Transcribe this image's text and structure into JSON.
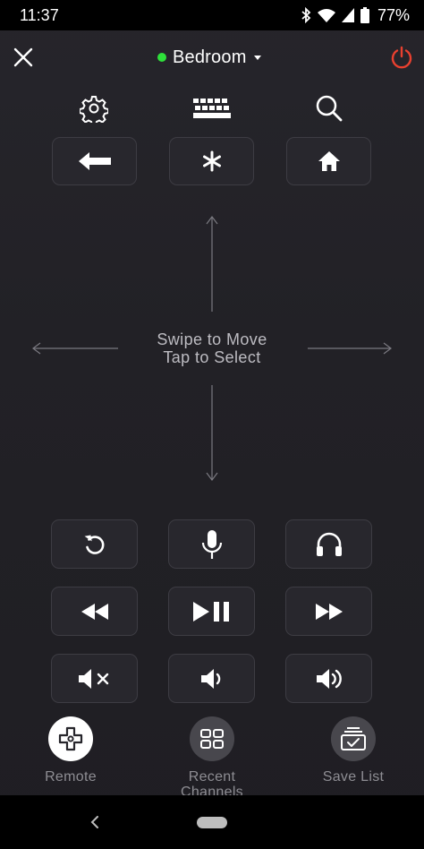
{
  "status_bar": {
    "time": "11:37",
    "battery": "77%",
    "icons": [
      "bluetooth-icon",
      "wifi-icon",
      "cell-signal-icon",
      "battery-icon"
    ]
  },
  "header": {
    "close_icon": "close-icon",
    "device_name": "Bedroom",
    "device_status_color": "#2ee03a",
    "power_icon": "power-icon",
    "power_color": "#e8402f"
  },
  "top_controls": [
    "gear-icon",
    "keyboard-icon",
    "search-icon"
  ],
  "nav_buttons": [
    "back-arrow-icon",
    "asterisk-icon",
    "home-icon"
  ],
  "swipe": {
    "line1": "Swipe to Move",
    "line2": "Tap to Select"
  },
  "control_grid": [
    [
      "replay-icon",
      "microphone-icon",
      "headphones-icon"
    ],
    [
      "rewind-icon",
      "play-pause-icon",
      "fast-forward-icon"
    ],
    [
      "mute-icon",
      "volume-down-icon",
      "volume-up-icon"
    ]
  ],
  "tabs": [
    {
      "label": "Remote",
      "icon": "dpad-icon",
      "active": true
    },
    {
      "label": "Recent Channels",
      "icon": "grid-icon",
      "active": false
    },
    {
      "label": "Save List",
      "icon": "save-list-icon",
      "active": false
    }
  ],
  "system_nav": [
    "back-nav-icon",
    "home-pill"
  ]
}
